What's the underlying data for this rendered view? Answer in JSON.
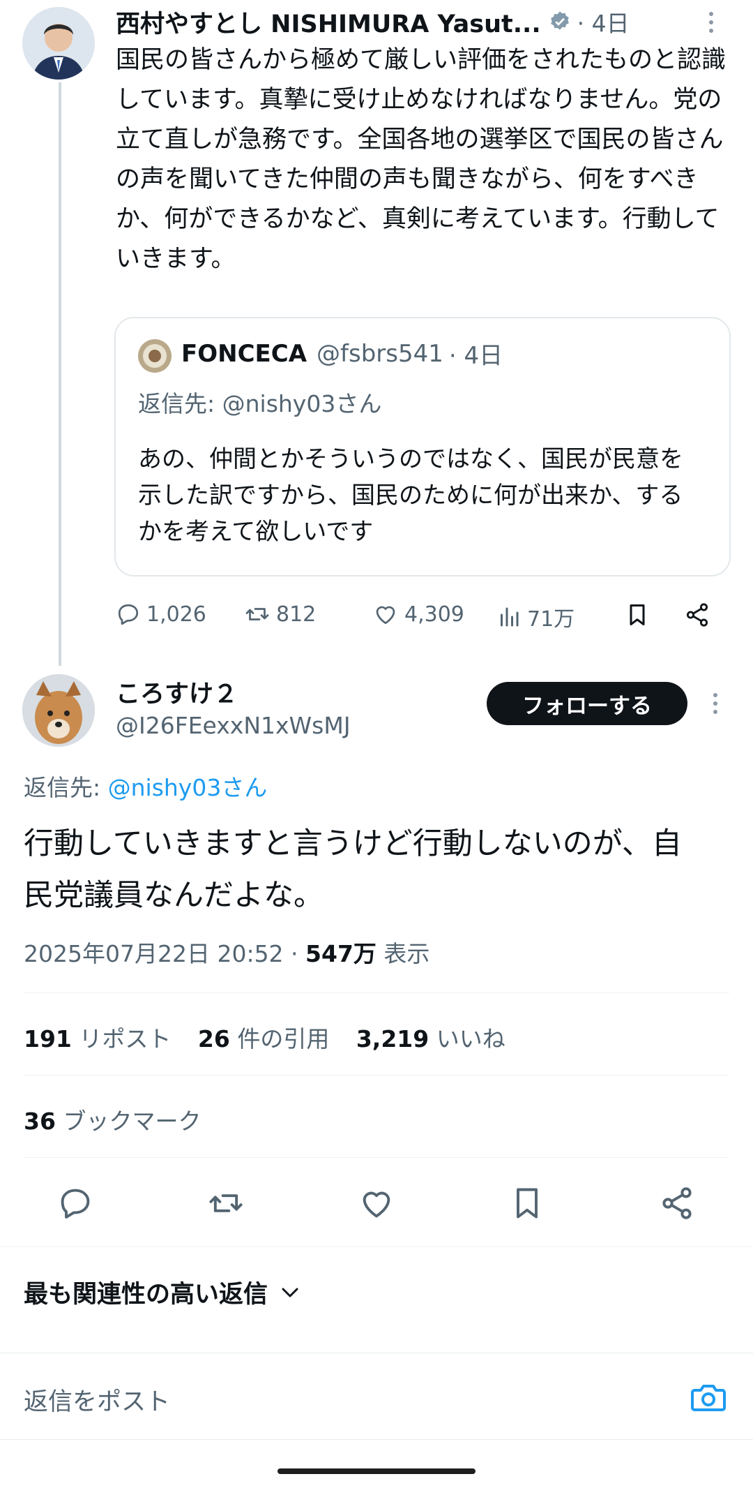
{
  "parent_tweet": {
    "author_name": "西村やすとし NISHIMURA Yasut...",
    "time": "· 4日",
    "body": "国民の皆さんから極めて厳しい評価をされたものと認識しています。真摯に受け止めなければなりません。党の立て直しが急務です。全国各地の選挙区で国民の皆さんの声を聞いてきた仲間の声も聞きながら、何をすべきか、何ができるかなど、真剣に考えています。行動していきます。",
    "quote": {
      "author_name": "FONCECA",
      "handle": "@fsbrs541",
      "time": "· 4日",
      "reply_to": "返信先: @nishy03さん",
      "body": "あの、仲間とかそういうのではなく、国民が民意を示した訳ですから、国民のために何が出来か、するかを考えて欲しいです"
    },
    "actions": {
      "replies": "1,026",
      "reposts": "812",
      "likes": "4,309",
      "views": "71万"
    }
  },
  "main_tweet": {
    "author_name": "ころすけ２",
    "handle": "@I26FEexxN1xWsMJ",
    "follow_label": "フォローする",
    "reply_to_prefix": "返信先: ",
    "reply_to_handle": "@nishy03さん",
    "body": "行動していきますと言うけど行動しないのが、自民党議員なんだよな。",
    "timestamp": "2025年07月22日 20:52 · ",
    "views_count": "547万",
    "views_label": " 表示",
    "stats": {
      "reposts_count": "191",
      "reposts_label": "リポスト",
      "quotes_count": "26",
      "quotes_label": "件の引用",
      "likes_count": "3,219",
      "likes_label": "いいね",
      "bookmarks_count": "36",
      "bookmarks_label": "ブックマーク"
    }
  },
  "replies_sort": {
    "label": "最も関連性の高い返信"
  },
  "reply_bar": {
    "placeholder": "返信をポスト"
  },
  "colors": {
    "accent": "#1d9bf0",
    "text": "#0f1419",
    "muted": "#536471",
    "border": "#eff3f4"
  }
}
